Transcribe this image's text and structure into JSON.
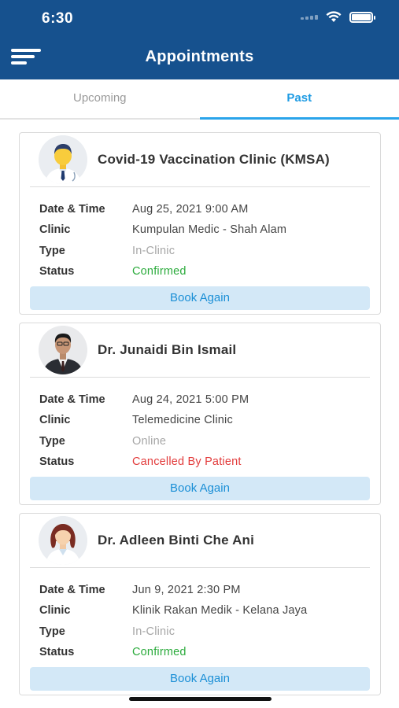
{
  "status_bar": {
    "time": "6:30"
  },
  "header": {
    "title": "Appointments"
  },
  "tabs": [
    {
      "label": "Upcoming",
      "active": false
    },
    {
      "label": "Past",
      "active": true
    }
  ],
  "labels": {
    "date_time": "Date & Time",
    "clinic": "Clinic",
    "type": "Type",
    "status": "Status"
  },
  "appointments": [
    {
      "title": "Covid-19 Vaccination Clinic (KMSA)",
      "date_time": "Aug 25, 2021 9:00 AM",
      "clinic": "Kumpulan Medic - Shah Alam",
      "type": "In-Clinic",
      "status": "Confirmed",
      "status_color": "#2bab3c",
      "avatar": "male-doctor-illustration",
      "button": "Book Again"
    },
    {
      "title": "Dr. Junaidi Bin Ismail",
      "date_time": "Aug 24, 2021 5:00 PM",
      "clinic": "Telemedicine Clinic",
      "type": "Online",
      "status": "Cancelled By Patient",
      "status_color": "#e23b3b",
      "avatar": "doctor-photo",
      "button": "Book Again"
    },
    {
      "title": "Dr. Adleen Binti Che Ani",
      "date_time": "Jun 9, 2021 2:30 PM",
      "clinic": "Klinik Rakan Medik - Kelana Jaya",
      "type": "In-Clinic",
      "status": "Confirmed",
      "status_color": "#2bab3c",
      "avatar": "female-doctor-illustration",
      "button": "Book Again"
    }
  ],
  "colors": {
    "header_bg": "#16518e",
    "accent": "#1e9be3",
    "button_bg": "#d3e8f7"
  }
}
